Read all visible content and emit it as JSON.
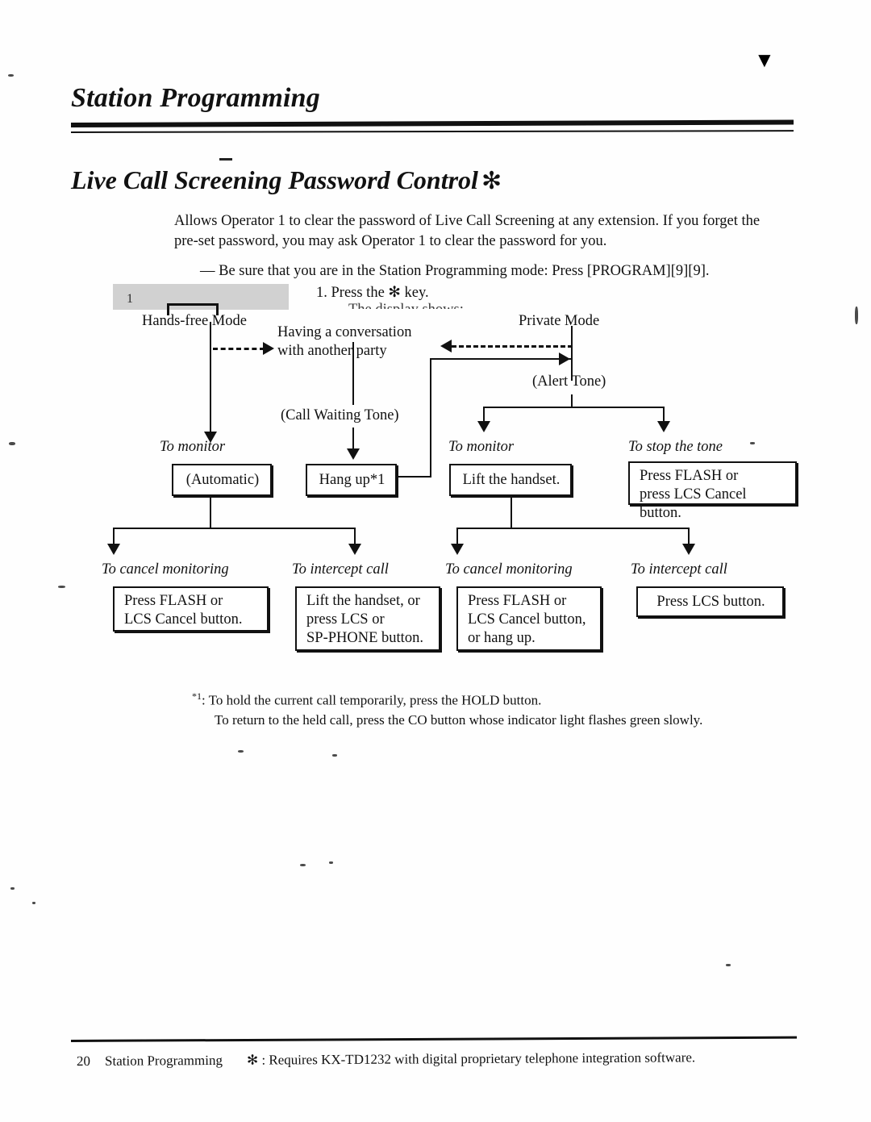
{
  "document": {
    "header_title": "Station Programming",
    "section_title": "Live Call Screening Password Control",
    "section_asterisk": "✻",
    "corner_mark": "▼"
  },
  "intro": {
    "paragraph": "Allows Operator 1 to clear the password of Live Call Screening at any extension.  If you forget the pre-set password, you may ask Operator 1 to clear the password for you.",
    "mode_note": "— Be sure that you are in the Station Programming mode: Press [PROGRAM][9][9].",
    "step_one": "1.  Press the ✻ key.",
    "display_shows": "The display shows:",
    "artifact_number": "1"
  },
  "diagram": {
    "mode_left": "Hands-free Mode",
    "mode_right": "Private Mode",
    "conversation_line1": "Having a conversation",
    "conversation_line2": "with another party",
    "call_waiting_tone": "(Call Waiting Tone)",
    "alert_tone": "(Alert Tone)",
    "labels": {
      "to_monitor_left": "To monitor",
      "to_monitor_right": "To monitor",
      "to_stop_the_tone": "To stop the tone",
      "to_cancel_monitoring_1": "To cancel monitoring",
      "to_intercept_call_1": "To intercept call",
      "to_cancel_monitoring_2": "To cancel monitoring",
      "to_intercept_call_2": "To intercept call"
    },
    "boxes": {
      "automatic": "(Automatic)",
      "hang_up": "Hang up*1",
      "lift_handset": "Lift the handset.",
      "stop_tone_l1": "Press FLASH or",
      "stop_tone_l2": "press LCS Cancel button.",
      "cancel1_l1": "Press FLASH or",
      "cancel1_l2": "LCS Cancel button.",
      "intercept1_l1": "Lift the handset, or",
      "intercept1_l2": "press LCS or",
      "intercept1_l3": "SP-PHONE button.",
      "cancel2_l1": "Press FLASH or",
      "cancel2_l2": "LCS Cancel button,",
      "cancel2_l3": "or hang up.",
      "intercept2": "Press LCS button."
    }
  },
  "footnote": {
    "marker": "*1",
    "line1": ": To hold the current call temporarily, press the HOLD button.",
    "line2": "To return to the held call, press the CO button whose indicator light flashes green slowly."
  },
  "footer": {
    "page_number": "20",
    "section": "Station Programming",
    "note": "✻ : Requires KX-TD1232 with digital proprietary telephone integration software."
  }
}
